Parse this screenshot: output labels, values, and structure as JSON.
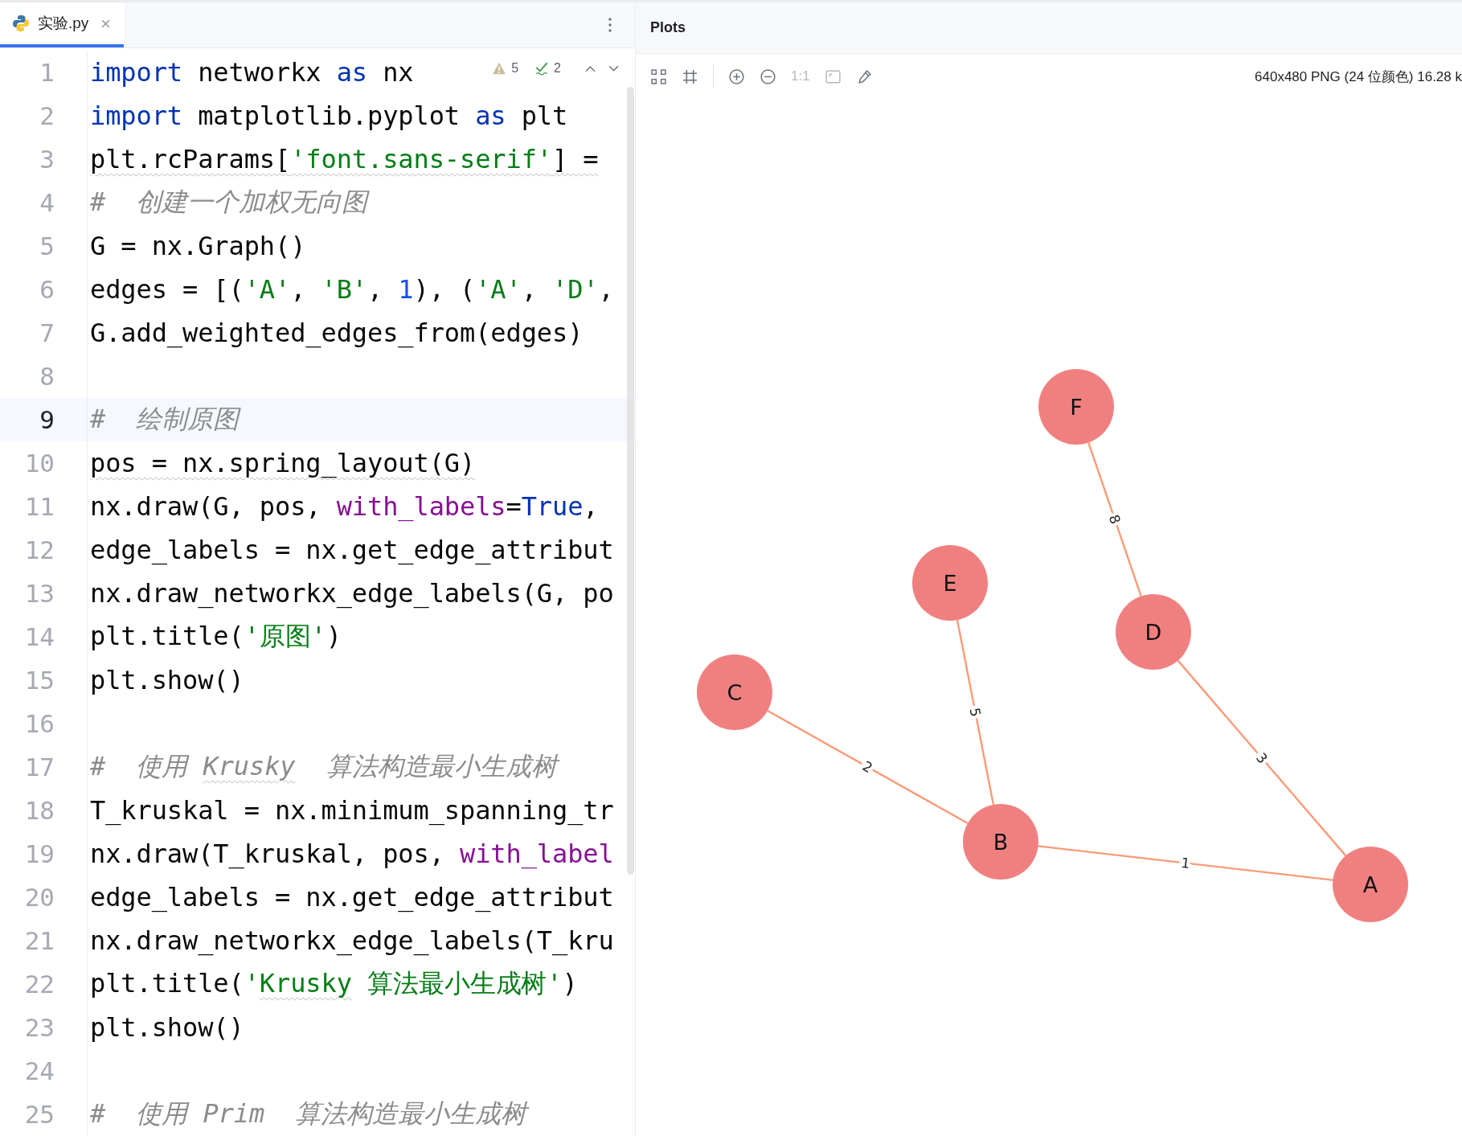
{
  "editor": {
    "tab": {
      "label": "实验.py",
      "selected": true
    },
    "inspections": {
      "warnings": "5",
      "checks": "2"
    },
    "lines": [
      {
        "number": "1",
        "current": false,
        "tokens": [
          {
            "t": "import",
            "kind": "kw"
          },
          {
            "t": " networkx ",
            "kind": "plain"
          },
          {
            "t": "as",
            "kind": "kw"
          },
          {
            "t": " nx",
            "kind": "plain"
          }
        ]
      },
      {
        "number": "2",
        "current": false,
        "tokens": [
          {
            "t": "import",
            "kind": "kw"
          },
          {
            "t": " matplotlib.pyplot ",
            "kind": "plain"
          },
          {
            "t": "as",
            "kind": "kw"
          },
          {
            "t": " plt",
            "kind": "plain"
          }
        ]
      },
      {
        "number": "3",
        "current": false,
        "tokens": [
          {
            "t": "plt.rcParams[",
            "kind": "plain",
            "squiggly": true
          },
          {
            "t": "'font.sans-serif'",
            "kind": "str",
            "squiggly": true
          },
          {
            "t": "] =",
            "kind": "plain",
            "squiggly": true
          }
        ]
      },
      {
        "number": "4",
        "current": false,
        "tokens": [
          {
            "t": "#  创建一个加权无向图",
            "kind": "comment"
          }
        ]
      },
      {
        "number": "5",
        "current": false,
        "tokens": [
          {
            "t": "G = nx.Graph()",
            "kind": "plain"
          }
        ]
      },
      {
        "number": "6",
        "current": false,
        "tokens": [
          {
            "t": "edges = [(",
            "kind": "plain"
          },
          {
            "t": "'A'",
            "kind": "str"
          },
          {
            "t": ", ",
            "kind": "plain"
          },
          {
            "t": "'B'",
            "kind": "str"
          },
          {
            "t": ", ",
            "kind": "plain"
          },
          {
            "t": "1",
            "kind": "num"
          },
          {
            "t": "), (",
            "kind": "plain"
          },
          {
            "t": "'A'",
            "kind": "str"
          },
          {
            "t": ", ",
            "kind": "plain"
          },
          {
            "t": "'D'",
            "kind": "str"
          },
          {
            "t": ",",
            "kind": "plain"
          }
        ]
      },
      {
        "number": "7",
        "current": false,
        "tokens": [
          {
            "t": "G.add_weighted_edges_from(edges)",
            "kind": "plain"
          }
        ]
      },
      {
        "number": "8",
        "current": false
      },
      {
        "number": "9",
        "current": true,
        "tokens": [
          {
            "t": "#  绘制原图",
            "kind": "comment"
          }
        ]
      },
      {
        "number": "10",
        "current": false,
        "tokens": [
          {
            "t": "pos = nx.spring_layout(G)",
            "kind": "plain",
            "squiggly": true
          }
        ]
      },
      {
        "number": "11",
        "current": false,
        "tokens": [
          {
            "t": "nx.draw(G, pos, ",
            "kind": "plain"
          },
          {
            "t": "with_labels",
            "kind": "param"
          },
          {
            "t": "=",
            "kind": "plain"
          },
          {
            "t": "True",
            "kind": "kw"
          },
          {
            "t": ",",
            "kind": "plain"
          }
        ]
      },
      {
        "number": "12",
        "current": false,
        "tokens": [
          {
            "t": "edge_labels = nx.get_edge_attribut",
            "kind": "plain"
          }
        ]
      },
      {
        "number": "13",
        "current": false,
        "tokens": [
          {
            "t": "nx.draw_networkx_edge_labels(G, po",
            "kind": "plain"
          }
        ]
      },
      {
        "number": "14",
        "current": false,
        "tokens": [
          {
            "t": "plt.title(",
            "kind": "plain"
          },
          {
            "t": "'原图'",
            "kind": "str"
          },
          {
            "t": ")",
            "kind": "plain"
          }
        ]
      },
      {
        "number": "15",
        "current": false,
        "tokens": [
          {
            "t": "plt.show()",
            "kind": "plain"
          }
        ]
      },
      {
        "number": "16",
        "current": false
      },
      {
        "number": "17",
        "current": false,
        "tokens": [
          {
            "t": "#  使用 ",
            "kind": "comment"
          },
          {
            "t": "Krusky",
            "kind": "comment",
            "squiggly": true
          },
          {
            "t": "  算法构造最小生成树",
            "kind": "comment"
          }
        ]
      },
      {
        "number": "18",
        "current": false,
        "tokens": [
          {
            "t": "T_kruskal = nx.minimum_spanning_tr",
            "kind": "plain"
          }
        ]
      },
      {
        "number": "19",
        "current": false,
        "tokens": [
          {
            "t": "nx.draw(T_kruskal, pos, ",
            "kind": "plain"
          },
          {
            "t": "with_label",
            "kind": "param"
          }
        ]
      },
      {
        "number": "20",
        "current": false,
        "tokens": [
          {
            "t": "edge_labels = nx.get_edge_attribut",
            "kind": "plain"
          }
        ]
      },
      {
        "number": "21",
        "current": false,
        "tokens": [
          {
            "t": "nx.draw_networkx_edge_labels(T_kru",
            "kind": "plain"
          }
        ]
      },
      {
        "number": "22",
        "current": false,
        "tokens": [
          {
            "t": "plt.title(",
            "kind": "plain"
          },
          {
            "t": "'",
            "kind": "str"
          },
          {
            "t": "Krusky",
            "kind": "str",
            "squiggly": true
          },
          {
            "t": " 算法最小生成树'",
            "kind": "str"
          },
          {
            "t": ")",
            "kind": "plain"
          }
        ]
      },
      {
        "number": "23",
        "current": false,
        "tokens": [
          {
            "t": "plt.show()",
            "kind": "plain"
          }
        ]
      },
      {
        "number": "24",
        "current": false
      },
      {
        "number": "25",
        "current": false,
        "tokens": [
          {
            "t": "#  使用 Prim  算法构造最小生成树",
            "kind": "comment"
          }
        ]
      }
    ]
  },
  "plots": {
    "title": "Plots",
    "actual_size": "1:1",
    "image_info": "640x480 PNG (24 位颜色) 16.28 k",
    "graph": {
      "nodes": [
        {
          "label": "F"
        },
        {
          "label": "E"
        },
        {
          "label": "D"
        },
        {
          "label": "C"
        },
        {
          "label": "B"
        },
        {
          "label": "A"
        }
      ],
      "edges": [
        {
          "label": "8"
        },
        {
          "label": "5"
        },
        {
          "label": "3"
        },
        {
          "label": "2"
        },
        {
          "label": "1"
        }
      ]
    }
  }
}
